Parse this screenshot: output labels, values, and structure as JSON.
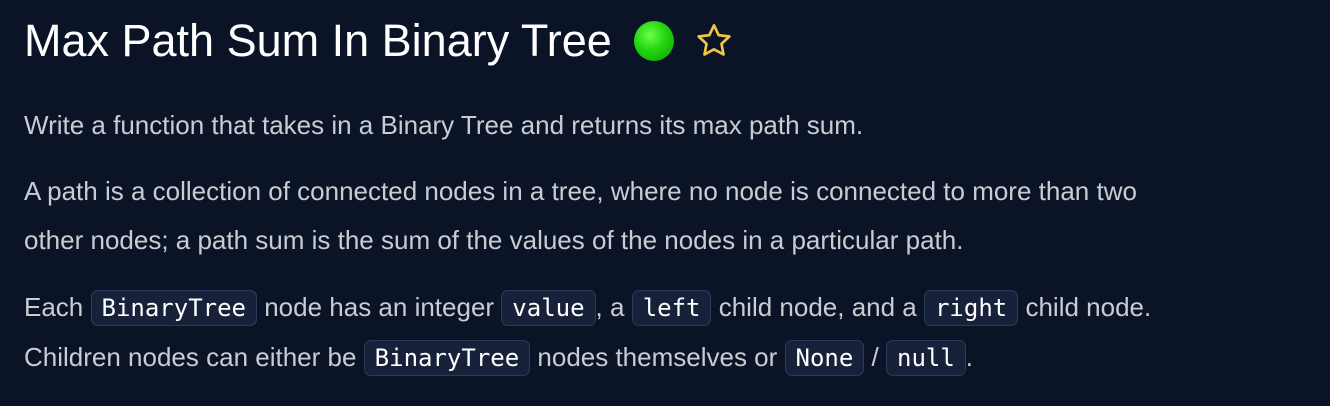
{
  "header": {
    "title": "Max Path Sum In Binary Tree",
    "status_icon": "green-circle",
    "status_color": "#22d40e",
    "star_icon": "star-outline",
    "star_color": "#f2c744"
  },
  "description": {
    "p1": "Write a function that takes in a Binary Tree and returns its max path sum.",
    "p2_line1": "A path is a collection of connected nodes in a tree, where no node is connected to more than two",
    "p2_line2": "other nodes; a path sum is the sum of the values of the nodes in a particular path.",
    "p3": {
      "t1": "Each ",
      "c1": "BinaryTree",
      "t2": " node has an integer ",
      "c2": "value",
      "t3": ", a ",
      "c3": "left",
      "t4": " child node, and a ",
      "c4": "right",
      "t5": " child node.",
      "t6": "Children nodes can either be ",
      "c5": "BinaryTree",
      "t7": " nodes themselves or ",
      "c6": "None",
      "t8": " / ",
      "c7": "null",
      "t9": "."
    }
  }
}
